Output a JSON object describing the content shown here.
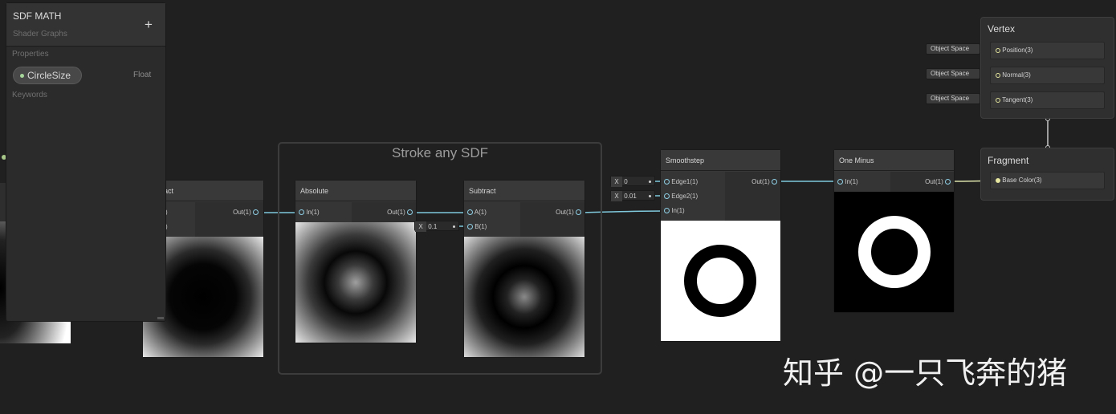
{
  "blackboard": {
    "title": "SDF MATH",
    "subtitle": "Shader Graphs",
    "add_label": "+",
    "properties_header": "Properties",
    "property": {
      "name": "CircleSize",
      "type": "Float"
    },
    "keywords_header": "Keywords"
  },
  "group": {
    "title": "Stroke any SDF"
  },
  "nodes": {
    "subtract_left": {
      "title": "act",
      "out": "Out(1)",
      "in_a": ")",
      "in_b": ")"
    },
    "absolute": {
      "title": "Absolute",
      "in": "In(1)",
      "out": "Out(1)"
    },
    "subtract": {
      "title": "Subtract",
      "in_a": "A(1)",
      "in_b": "B(1)",
      "out": "Out(1)",
      "b_x": "X",
      "b_value": "0.1"
    },
    "smoothstep": {
      "title": "Smoothstep",
      "in_edge1": "Edge1(1)",
      "in_edge2": "Edge2(1)",
      "in_in": "In(1)",
      "out": "Out(1)",
      "edge1_x": "X",
      "edge1_value": "0",
      "edge2_x": "X",
      "edge2_value": "0.01"
    },
    "one_minus": {
      "title": "One Minus",
      "in": "In(1)",
      "out": "Out(1)"
    }
  },
  "master": {
    "vertex": {
      "title": "Vertex",
      "ports": [
        {
          "label": "Position(3)",
          "space": "Object Space"
        },
        {
          "label": "Normal(3)",
          "space": "Object Space"
        },
        {
          "label": "Tangent(3)",
          "space": "Object Space"
        }
      ]
    },
    "fragment": {
      "title": "Fragment",
      "ports": [
        {
          "label": "Base Color(3)"
        }
      ]
    }
  },
  "watermark": "知乎 @一只飞奔的猪",
  "colors": {
    "background": "#202020",
    "wire": "#7fc8dc",
    "port": "#8fd0e6",
    "vector3": "#e6e6a0"
  }
}
